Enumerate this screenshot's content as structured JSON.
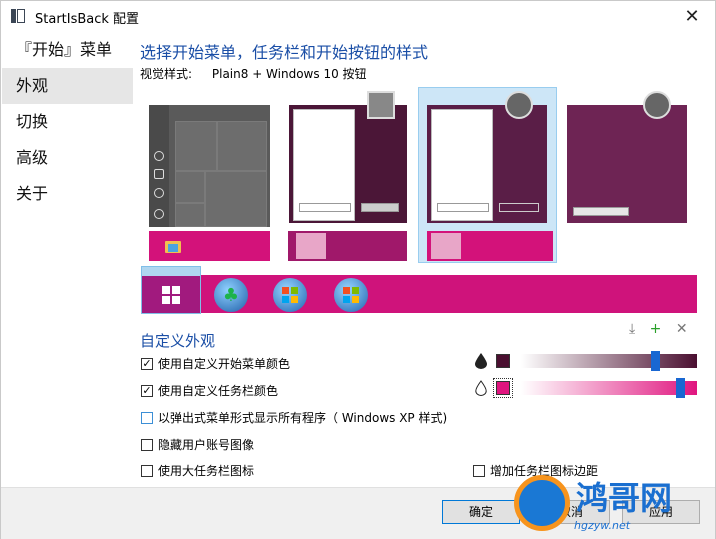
{
  "window": {
    "title": "StartIsBack 配置",
    "close_glyph": "✕"
  },
  "sidebar": {
    "items": [
      {
        "label": "『开始』菜单",
        "active": false
      },
      {
        "label": "外观",
        "active": true
      },
      {
        "label": "切换",
        "active": false
      },
      {
        "label": "高级",
        "active": false
      },
      {
        "label": "关于",
        "active": false
      }
    ]
  },
  "main": {
    "heading": "选择开始菜单，任务栏和开始按钮的样式",
    "visual_style_label": "视觉样式:",
    "visual_style_value": "Plain8 + Windows 10 按钮",
    "custom_section_title": "自定义外观",
    "options": [
      {
        "label": "使用自定义开始菜单颜色",
        "checked": true
      },
      {
        "label": "使用自定义任务栏颜色",
        "checked": true
      },
      {
        "label": "以弹出式菜单形式显示所有程序（ Windows XP 样式)",
        "checked": false
      },
      {
        "label": "隐藏用户账号图像",
        "checked": false
      },
      {
        "label": "使用大任务栏图标",
        "checked": false
      },
      {
        "label": "增加任务栏图标边距",
        "checked": false
      }
    ],
    "check_glyph": "✓",
    "tool_icons": {
      "download": "⤓",
      "add": "+",
      "remove": "✕"
    },
    "start_menu_color": "#4a0f30",
    "taskbar_color": "#e0157f",
    "start_menu_slider_level": 0.78,
    "taskbar_slider_level": 0.93,
    "drop_filled_glyph": "💧",
    "drop_outline_glyph": "💧"
  },
  "footer": {
    "ok": "确定",
    "cancel": "取消",
    "apply": "应用"
  },
  "watermark": {
    "brand": "鸿哥网",
    "url": "hgzyw.net"
  },
  "colors": {
    "accent": "#1a4ea6",
    "taskbar_pink": "#d3127a",
    "menu_purple": "#5e1c47"
  }
}
